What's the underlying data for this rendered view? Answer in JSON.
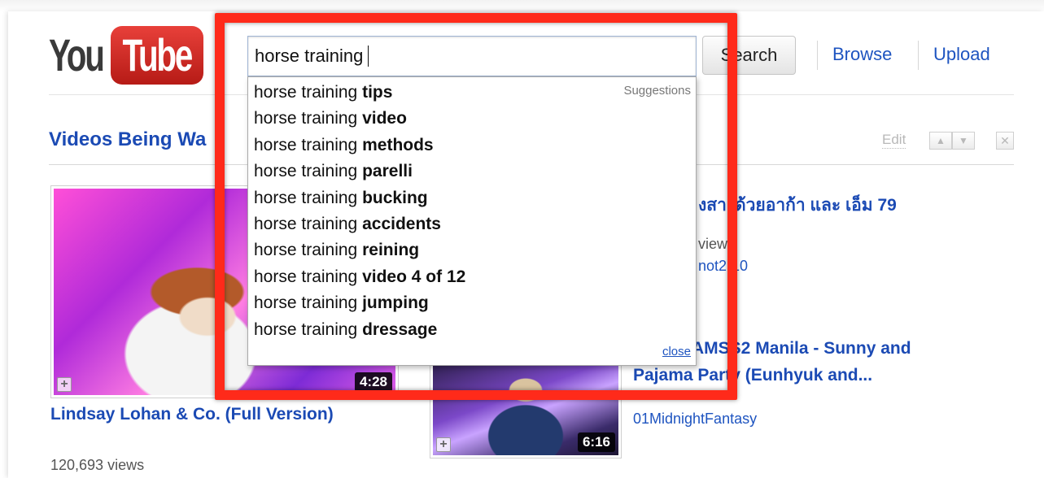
{
  "logo": {
    "you": "You",
    "tube": "Tube"
  },
  "search": {
    "query": "horse training",
    "button_label": "Search"
  },
  "nav": {
    "browse": "Browse",
    "upload": "Upload"
  },
  "section": {
    "title_visible": "Videos Being Wa",
    "edit_label": "Edit",
    "up_glyph": "▲",
    "down_glyph": "▼",
    "close_glyph": "✕"
  },
  "suggestions": {
    "header": "Suggestions",
    "prefix": "horse training",
    "items": [
      "tips",
      "video",
      "methods",
      "parelli",
      "bucking",
      "accidents",
      "reining",
      "video 4 of 12",
      "jumping",
      "dressage"
    ],
    "close_label": "close"
  },
  "videos": [
    {
      "title": "Lindsay Lohan & Co. (Full Version)",
      "views": "120,693 views",
      "duration": "4:28"
    },
    {
      "duration": "6:16",
      "channel": "01MidnightFantasy",
      "title_line1_visible": "AM",
      "title_line1_rest": "SS2 Manila - Sunny and",
      "title_line2_visible": "Pajama Pa",
      "title_line2_rest": "rty (Eunhyuk and..."
    },
    {
      "title_fragment_1": "งสา",
      "title_fragment_2": "ด้วยอาก้า และ เอ็ม 79",
      "views_fragment": "view",
      "channel_fragment_1": "not2",
      "channel_fragment_2": "10"
    }
  ],
  "colors": {
    "highlight": "#ff2a1a",
    "link": "#1e54c0",
    "title": "#1b4ab4"
  },
  "icons": {
    "thumb_add": "+"
  }
}
